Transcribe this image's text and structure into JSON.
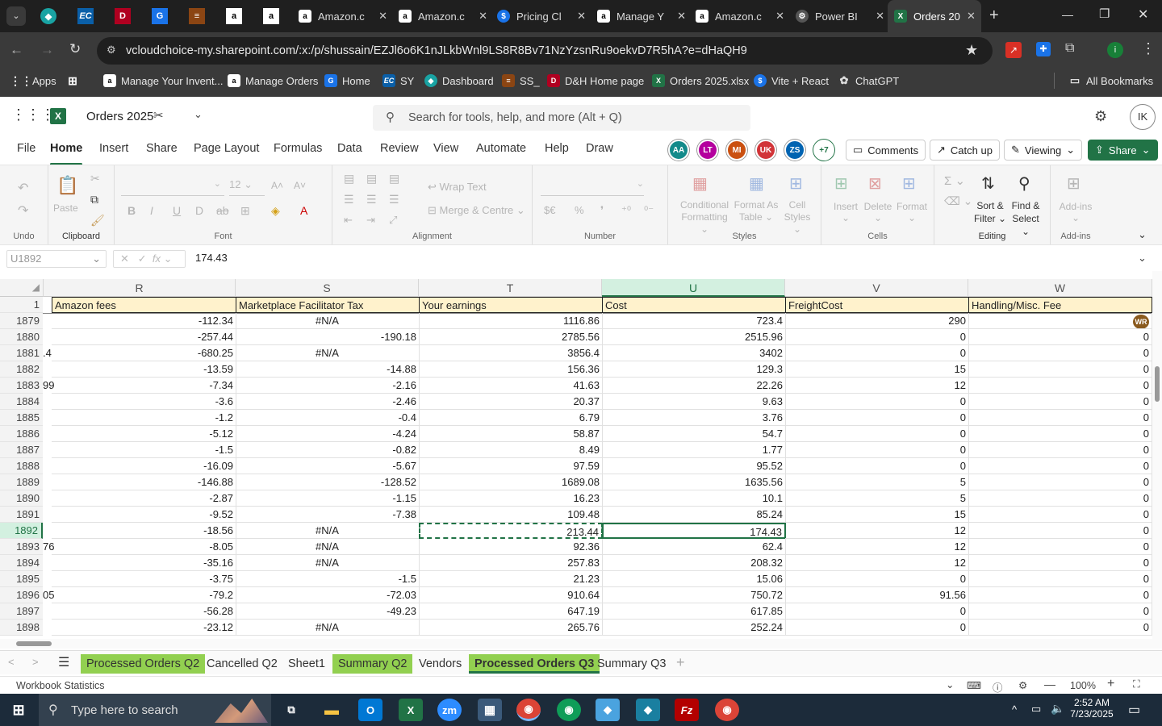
{
  "browser": {
    "tabs": [
      {
        "title": "Amazon.c",
        "icon": "amazon-icon"
      },
      {
        "title": "Amazon.c",
        "icon": "amazon-icon"
      },
      {
        "title": "Pricing Cl",
        "icon": "dollar-icon"
      },
      {
        "title": "Manage Y",
        "icon": "amazon-icon"
      },
      {
        "title": "Amazon.c",
        "icon": "amazon-icon"
      },
      {
        "title": "Power BI",
        "icon": "power-bi-icon"
      },
      {
        "title": "Orders 20",
        "icon": "excel-icon"
      }
    ],
    "url": "vcloudchoice-my.sharepoint.com/:x:/p/shussain/EZJl6o6K1nJLkbWnl9LS8R8Bv71NzYzsnRu9oekvD7R5hA?e=dHaQH9",
    "bookmarks": [
      "Apps",
      "Manage Your Invent...",
      "Manage Orders",
      "Home",
      "SY",
      "Dashboard",
      "SS_",
      "D&H Home page",
      "Orders 2025.xlsx",
      "Vite + React",
      "ChatGPT"
    ],
    "all_bookmarks": "All Bookmarks"
  },
  "excel": {
    "file_name": "Orders 2025",
    "search_placeholder": "Search for tools, help, and more (Alt + Q)",
    "user_initials": "IK",
    "menu": [
      "File",
      "Home",
      "Insert",
      "Share",
      "Page Layout",
      "Formulas",
      "Data",
      "Review",
      "View",
      "Automate",
      "Help",
      "Draw"
    ],
    "collaborators": [
      {
        "initials": "AA",
        "color": "#138a8a"
      },
      {
        "initials": "LT",
        "color": "#b4009e"
      },
      {
        "initials": "MI",
        "color": "#ca5010"
      },
      {
        "initials": "UK",
        "color": "#d13438"
      },
      {
        "initials": "ZS",
        "color": "#0063b1"
      }
    ],
    "more_collaborators": "+7",
    "comments_label": "Comments",
    "catchup_label": "Catch up",
    "viewing_label": "Viewing",
    "share_label": "Share",
    "ribbon": {
      "undo": "Undo",
      "paste": "Paste",
      "clipboard": "Clipboard",
      "font_size": "12",
      "font": "Font",
      "wrap_text": "Wrap Text",
      "merge_centre": "Merge & Centre",
      "alignment": "Alignment",
      "number": "Number",
      "conditional": [
        "Conditional",
        "Formatting"
      ],
      "format_table": [
        "Format As",
        "Table"
      ],
      "cell_styles": [
        "Cell",
        "Styles"
      ],
      "styles": "Styles",
      "insert": "Insert",
      "delete": "Delete",
      "format": "Format",
      "cells": "Cells",
      "sort_filter": [
        "Sort &",
        "Filter"
      ],
      "find_select": [
        "Find &",
        "Select"
      ],
      "editing": "Editing",
      "addins": "Add-ins"
    },
    "name_box": "U1892",
    "formula_value": "174.43",
    "columns": [
      "R",
      "S",
      "T",
      "U",
      "V",
      "W"
    ],
    "header_row_num": "1",
    "headers": [
      "Amazon fees",
      "Marketplace Facilitator Tax",
      "Your earnings",
      "Cost",
      "FreightCost",
      "Handling/Misc. Fee"
    ],
    "clipped_prefix": {
      "1881": ".4",
      "1883": "99",
      "1893": "76",
      "1896": "05"
    },
    "rows": [
      {
        "n": "1879",
        "cells": [
          "-112.34",
          "#N/A",
          "1116.86",
          "723.4",
          "290",
          "WR"
        ]
      },
      {
        "n": "1880",
        "cells": [
          "-257.44",
          "-190.18",
          "2785.56",
          "2515.96",
          "0",
          "0"
        ]
      },
      {
        "n": "1881",
        "cells": [
          "-680.25",
          "#N/A",
          "3856.4",
          "3402",
          "0",
          "0"
        ]
      },
      {
        "n": "1882",
        "cells": [
          "-13.59",
          "-14.88",
          "156.36",
          "129.3",
          "15",
          "0"
        ]
      },
      {
        "n": "1883",
        "cells": [
          "-7.34",
          "-2.16",
          "41.63",
          "22.26",
          "12",
          "0"
        ]
      },
      {
        "n": "1884",
        "cells": [
          "-3.6",
          "-2.46",
          "20.37",
          "9.63",
          "0",
          "0"
        ]
      },
      {
        "n": "1885",
        "cells": [
          "-1.2",
          "-0.4",
          "6.79",
          "3.76",
          "0",
          "0"
        ]
      },
      {
        "n": "1886",
        "cells": [
          "-5.12",
          "-4.24",
          "58.87",
          "54.7",
          "0",
          "0"
        ]
      },
      {
        "n": "1887",
        "cells": [
          "-1.5",
          "-0.82",
          "8.49",
          "1.77",
          "0",
          "0"
        ]
      },
      {
        "n": "1888",
        "cells": [
          "-16.09",
          "-5.67",
          "97.59",
          "95.52",
          "0",
          "0"
        ]
      },
      {
        "n": "1889",
        "cells": [
          "-146.88",
          "-128.52",
          "1689.08",
          "1635.56",
          "5",
          "0"
        ]
      },
      {
        "n": "1890",
        "cells": [
          "-2.87",
          "-1.15",
          "16.23",
          "10.1",
          "5",
          "0"
        ]
      },
      {
        "n": "1891",
        "cells": [
          "-9.52",
          "-7.38",
          "109.48",
          "85.24",
          "15",
          "0"
        ]
      },
      {
        "n": "1892",
        "cells": [
          "-18.56",
          "#N/A",
          "213.44",
          "174.43",
          "12",
          "0"
        ]
      },
      {
        "n": "1893",
        "cells": [
          "-8.05",
          "#N/A",
          "92.36",
          "62.4",
          "12",
          "0"
        ]
      },
      {
        "n": "1894",
        "cells": [
          "-35.16",
          "#N/A",
          "257.83",
          "208.32",
          "12",
          "0"
        ]
      },
      {
        "n": "1895",
        "cells": [
          "-3.75",
          "-1.5",
          "21.23",
          "15.06",
          "0",
          "0"
        ]
      },
      {
        "n": "1896",
        "cells": [
          "-79.2",
          "-72.03",
          "910.64",
          "750.72",
          "91.56",
          "0"
        ]
      },
      {
        "n": "1897",
        "cells": [
          "-56.28",
          "-49.23",
          "647.19",
          "617.85",
          "0",
          "0"
        ]
      },
      {
        "n": "1898",
        "cells": [
          "-23.12",
          "#N/A",
          "265.76",
          "252.24",
          "0",
          "0"
        ]
      }
    ],
    "selected_row": "1892",
    "sheets": [
      {
        "name": "Processed Orders Q2",
        "green": true,
        "active": false
      },
      {
        "name": "Cancelled Q2",
        "green": false,
        "active": false
      },
      {
        "name": "Sheet1",
        "green": false,
        "active": false
      },
      {
        "name": "Summary Q2",
        "green": true,
        "active": false
      },
      {
        "name": "Vendors",
        "green": false,
        "active": false
      },
      {
        "name": "Processed Orders Q3",
        "green": true,
        "active": true
      },
      {
        "name": "Summary Q3",
        "green": false,
        "active": false
      }
    ],
    "status_left": "Workbook Statistics",
    "zoom": "100%"
  },
  "taskbar": {
    "search_placeholder": "Type here to search",
    "time": "2:52 AM",
    "date": "7/23/2025"
  }
}
